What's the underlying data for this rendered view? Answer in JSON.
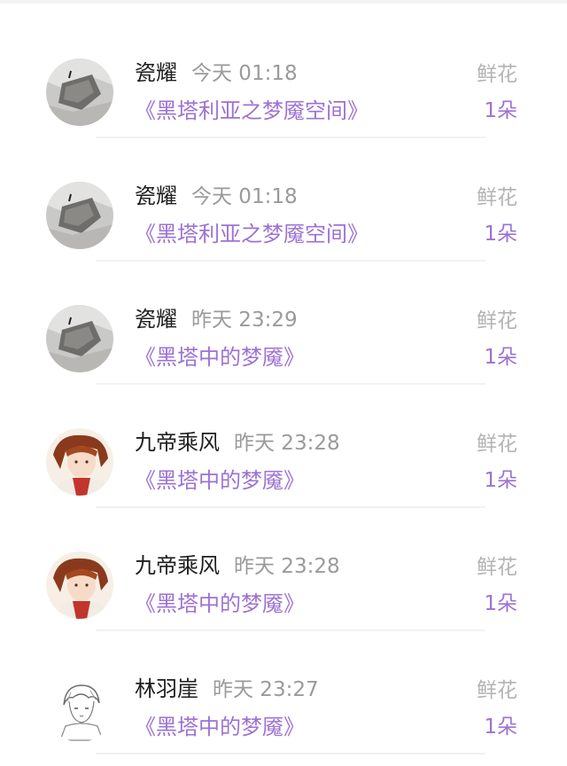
{
  "gifts": [
    {
      "user": "瓷耀",
      "time": "今天 01:18",
      "book": "《黑塔利亚之梦魇空间》",
      "gift": "鲜花",
      "count": "1朵",
      "avatar": "avatar-stone"
    },
    {
      "user": "瓷耀",
      "time": "今天 01:18",
      "book": "《黑塔利亚之梦魇空间》",
      "gift": "鲜花",
      "count": "1朵",
      "avatar": "avatar-stone"
    },
    {
      "user": "瓷耀",
      "time": "昨天 23:29",
      "book": "《黑塔中的梦魇》",
      "gift": "鲜花",
      "count": "1朵",
      "avatar": "avatar-stone"
    },
    {
      "user": "九帝乘风",
      "time": "昨天 23:28",
      "book": "《黑塔中的梦魇》",
      "gift": "鲜花",
      "count": "1朵",
      "avatar": "avatar-anime-redhair"
    },
    {
      "user": "九帝乘风",
      "time": "昨天 23:28",
      "book": "《黑塔中的梦魇》",
      "gift": "鲜花",
      "count": "1朵",
      "avatar": "avatar-anime-redhair"
    },
    {
      "user": "林羽崖",
      "time": "昨天 23:27",
      "book": "《黑塔中的梦魇》",
      "gift": "鲜花",
      "count": "1朵",
      "avatar": "avatar-sketch"
    }
  ],
  "colors": {
    "accent": "#9c72d4",
    "name": "#1e1e1e",
    "muted": "#9a9a9a"
  }
}
